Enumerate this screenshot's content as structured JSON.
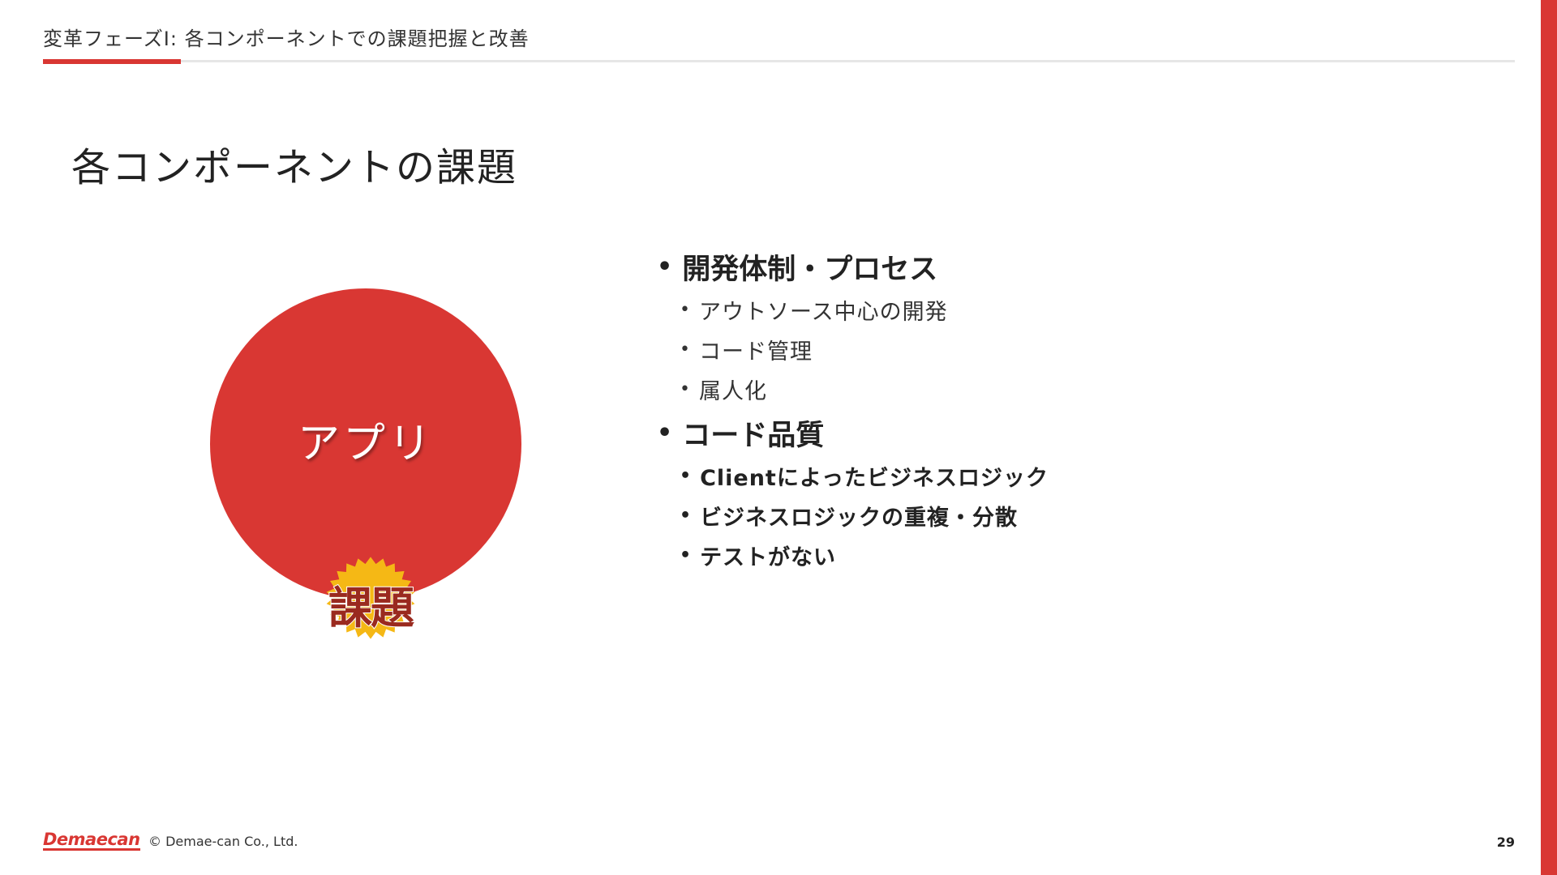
{
  "header": {
    "section_title": "変革フェーズⅠ: 各コンポーネントでの課題把握と改善"
  },
  "slide": {
    "title": "各コンポーネントの課題",
    "circle_label": "アプリ",
    "badge_label": "課題",
    "bullets": [
      {
        "heading": "開発体制・プロセス",
        "items": [
          {
            "text": "アウトソース中心の開発",
            "bold": false
          },
          {
            "text": "コード管理",
            "bold": false
          },
          {
            "text": "属人化",
            "bold": false
          }
        ]
      },
      {
        "heading": "コード品質",
        "items": [
          {
            "text": "Clientによったビジネスロジック",
            "bold": true
          },
          {
            "text": "ビジネスロジックの重複・分散",
            "bold": true
          },
          {
            "text": "テストがない",
            "bold": true
          }
        ]
      }
    ]
  },
  "footer": {
    "logo": "Demaecan",
    "copyright": "© Demae-can Co., Ltd.",
    "page_number": "29"
  },
  "colors": {
    "accent": "#d93733",
    "badge_fill": "#f5b815",
    "badge_text": "#9a2a1f"
  }
}
